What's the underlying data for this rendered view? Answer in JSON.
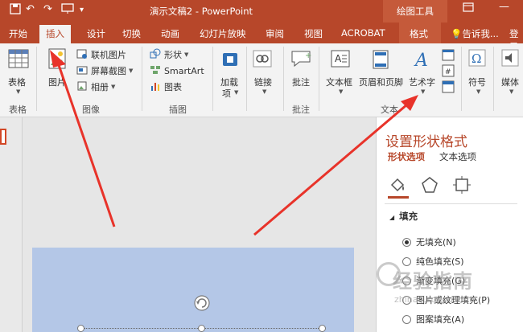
{
  "titlebar": {
    "title": "演示文稿2 - PowerPoint",
    "contextual_group": "绘图工具",
    "qat_icons": [
      "save-icon",
      "undo-icon",
      "redo-icon",
      "slideshow-icon",
      "customize-icon"
    ],
    "window_icons": [
      "ribbon-display-icon",
      "minimize-icon"
    ]
  },
  "tabs": {
    "items": [
      "开始",
      "插入",
      "设计",
      "切换",
      "动画",
      "幻灯片放映",
      "审阅",
      "视图",
      "ACROBAT",
      "格式"
    ],
    "active": "插入",
    "tell_me": "告诉我...",
    "sign_in": "登录"
  },
  "ribbon": {
    "tables": {
      "label": "表格",
      "group": "表格"
    },
    "images": {
      "picture": "图片",
      "online_picture": "联机图片",
      "screenshot": "屏幕截图",
      "album": "相册",
      "group": "图像"
    },
    "illustrations": {
      "shapes": "形状",
      "smartart": "SmartArt",
      "chart": "图表",
      "group": "插图"
    },
    "addins": {
      "label_line1": "加载",
      "label_line2": "项"
    },
    "links": {
      "label": "链接"
    },
    "comments": {
      "label": "批注",
      "group": "批注"
    },
    "text": {
      "textbox": "文本框",
      "header_footer": "页眉和页脚",
      "wordart": "艺术字",
      "group": "文本"
    },
    "symbols": {
      "label": "符号"
    },
    "media": {
      "label": "媒体"
    }
  },
  "pane": {
    "title": "设置形状格式",
    "tab_shape": "形状选项",
    "tab_text": "文本选项",
    "section": "填充",
    "options": [
      {
        "label": "无填充(N)",
        "checked": true
      },
      {
        "label": "纯色填充(S)",
        "checked": false
      },
      {
        "label": "渐变填充(G)",
        "checked": false
      },
      {
        "label": "图片或纹理填充(P)",
        "checked": false
      },
      {
        "label": "图案填充(A)",
        "checked": false
      }
    ]
  },
  "watermark": {
    "cn": "经验指南",
    "en": "zhinan.sogou.com"
  },
  "colors": {
    "accent": "#b7472a",
    "slide_fill": "#b4c7e7",
    "arrow": "#e8332a"
  }
}
